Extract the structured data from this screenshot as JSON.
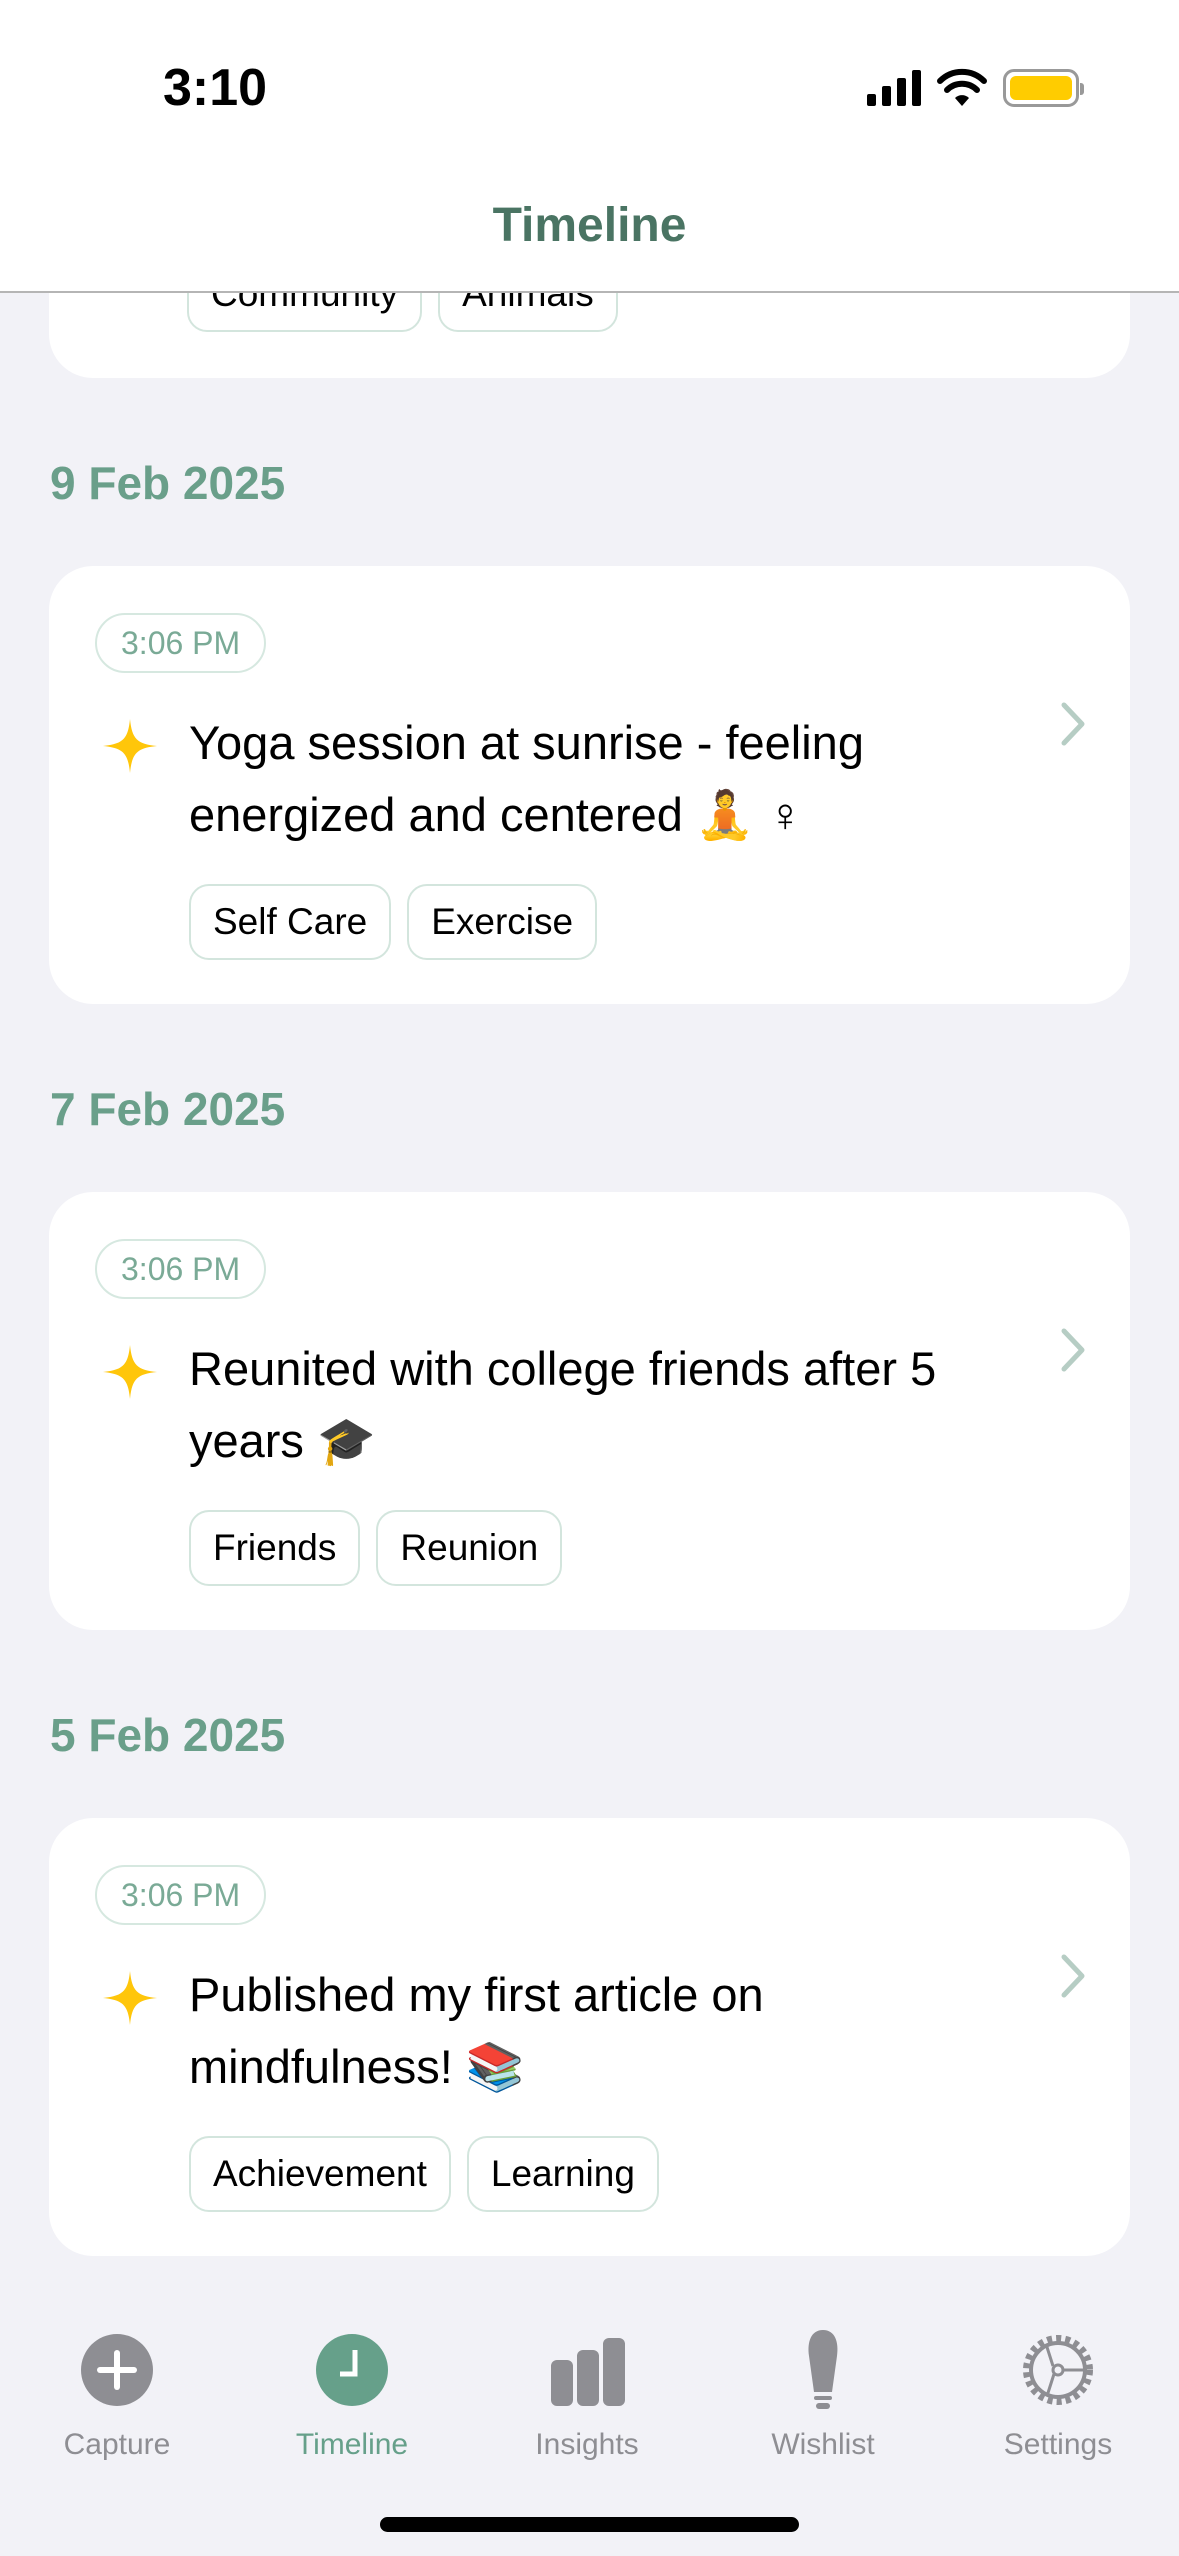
{
  "status_bar": {
    "time": "3:10",
    "battery_color": "#ffcc00"
  },
  "header": {
    "title": "Timeline"
  },
  "colors": {
    "accent": "#66a08a",
    "date": "#6a9f8a",
    "title": "#4a7463",
    "star": "#ffc60a",
    "inactive": "#8e8e93"
  },
  "partial_entry": {
    "tags": [
      "Community",
      "Animals"
    ]
  },
  "sections": [
    {
      "date": "9 Feb 2025",
      "entry": {
        "time": "3:06 PM",
        "icon": "sparkle-icon",
        "text": "Yoga session at sunrise - feeling energized and centered 🧘 ♀",
        "tags": [
          "Self Care",
          "Exercise"
        ]
      }
    },
    {
      "date": "7 Feb 2025",
      "entry": {
        "time": "3:06 PM",
        "icon": "sparkle-icon",
        "text": "Reunited with college friends after 5 years 🎓",
        "tags": [
          "Friends",
          "Reunion"
        ]
      }
    },
    {
      "date": "5 Feb 2025",
      "entry": {
        "time": "3:06 PM",
        "icon": "sparkle-icon",
        "text": "Published my first article on mindfulness! 📚",
        "tags": [
          "Achievement",
          "Learning"
        ]
      }
    }
  ],
  "tabbar": {
    "active": "Timeline",
    "items": [
      {
        "label": "Capture",
        "icon": "plus-circle-icon"
      },
      {
        "label": "Timeline",
        "icon": "clock-icon"
      },
      {
        "label": "Insights",
        "icon": "bar-chart-icon"
      },
      {
        "label": "Wishlist",
        "icon": "lightbulb-icon"
      },
      {
        "label": "Settings",
        "icon": "gear-icon"
      }
    ]
  }
}
